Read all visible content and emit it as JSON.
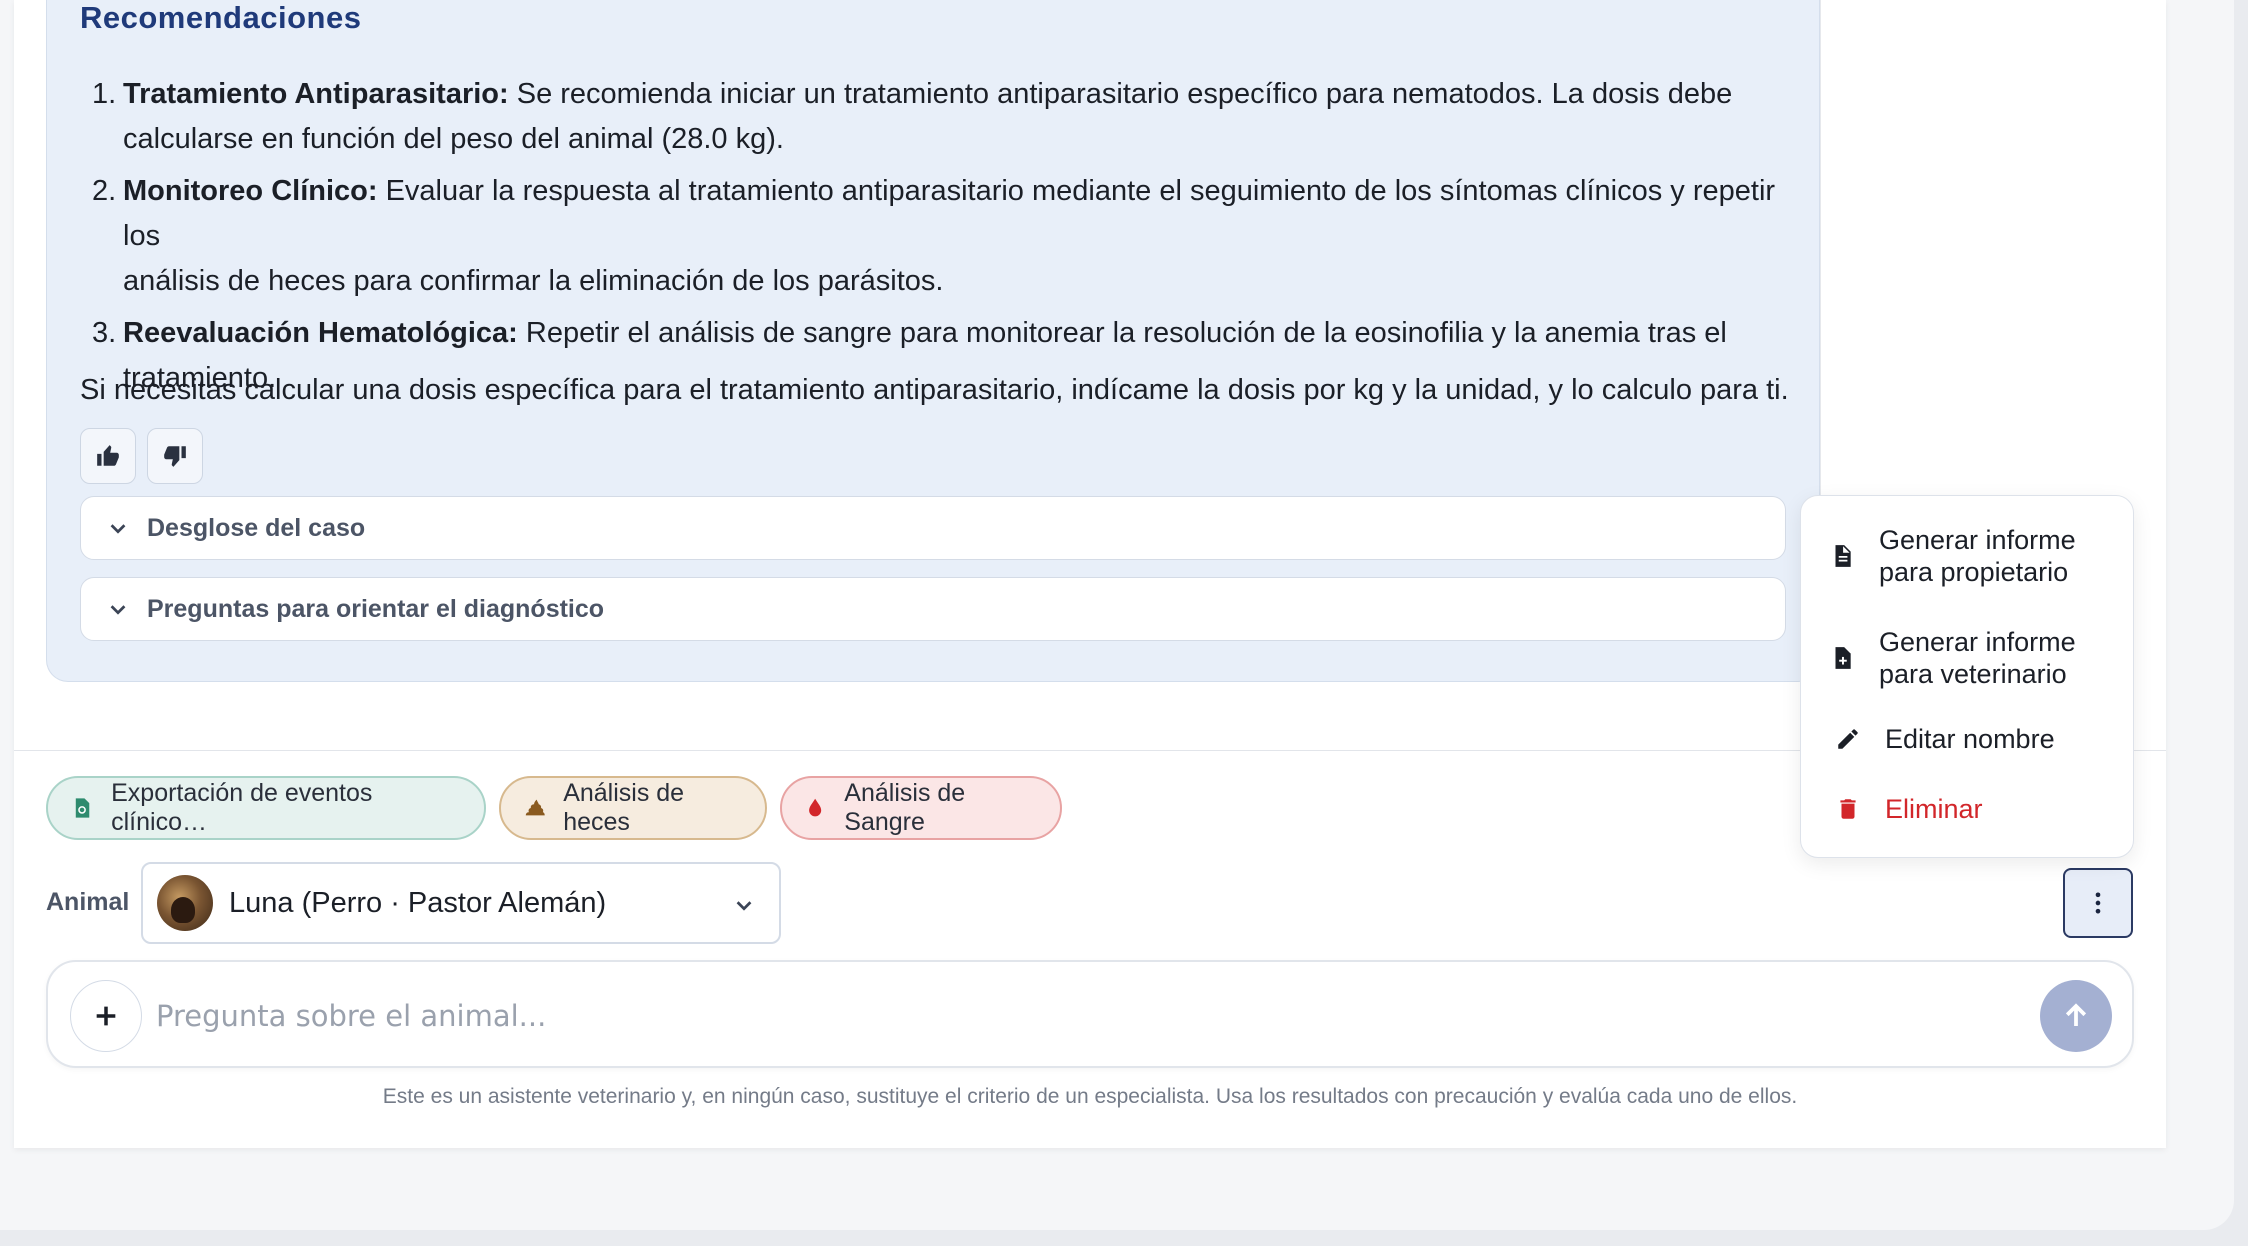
{
  "response": {
    "heading": "Recomendaciones",
    "recommendations": [
      {
        "number": "1.",
        "title": "Tratamiento Antiparasitario:",
        "line1": " Se recomienda iniciar un tratamiento antiparasitario específico para nematodos. La dosis debe",
        "line2": "calcularse en función del peso del animal (28.0 kg)."
      },
      {
        "number": "2.",
        "title": "Monitoreo Clínico:",
        "line1": " Evaluar la respuesta al tratamiento antiparasitario mediante el seguimiento de los síntomas clínicos y repetir los",
        "line2": "análisis de heces para confirmar la eliminación de los parásitos."
      },
      {
        "number": "3.",
        "title": "Reevaluación Hematológica:",
        "line1": " Repetir el análisis de sangre para monitorear la resolución de la eosinofilia y la anemia tras el",
        "line2": "tratamiento."
      }
    ],
    "closing": "Si necesitas calcular una dosis específica para el tratamiento antiparasitario, indícame la dosis por kg y la unidad, y lo calculo para ti.",
    "feedback": {
      "like_icon": "thumbs-up-icon",
      "dislike_icon": "thumbs-down-icon"
    },
    "accordions": [
      {
        "label": "Desglose del caso",
        "icon": "chevron-down-icon"
      },
      {
        "label": "Preguntas para orientar el diagnóstico",
        "icon": "chevron-down-icon"
      }
    ]
  },
  "attachments": [
    {
      "label": "Exportación de eventos clínico…",
      "icon": "file-spreadsheet-icon",
      "color": "#2e8b6e"
    },
    {
      "label": "Análisis de heces",
      "icon": "stool-icon",
      "color": "#8a5a1f"
    },
    {
      "label": "Análisis de Sangre",
      "icon": "blood-drop-icon",
      "color": "#d2262a"
    }
  ],
  "animal_selector": {
    "label": "Animal",
    "selected": "Luna (Perro · Pastor Alemán)"
  },
  "menu": {
    "items": [
      {
        "line1": "Generar informe",
        "line2": "para propietario",
        "icon": "document-icon"
      },
      {
        "line1": "Generar informe",
        "line2": "para veterinario",
        "icon": "document-plus-icon"
      },
      {
        "line1": "Editar nombre",
        "icon": "pencil-icon"
      },
      {
        "line1": "Eliminar",
        "icon": "trash-icon",
        "color": "#d2262a"
      }
    ],
    "trigger_icon": "more-vertical-icon"
  },
  "composer": {
    "placeholder": "Pregunta sobre el animal...",
    "value": "",
    "add_icon": "plus-icon",
    "send_icon": "arrow-up-icon"
  },
  "disclaimer": "Este es un asistente veterinario y, en ningún caso, sustituye el criterio de un especialista. Usa los resultados con precaución y evalúa cada uno de ellos.",
  "colors": {
    "heading": "#1f3a7a",
    "response_bg": "#e8eff9",
    "send_button": "#a4b0d2",
    "danger": "#d2262a"
  }
}
